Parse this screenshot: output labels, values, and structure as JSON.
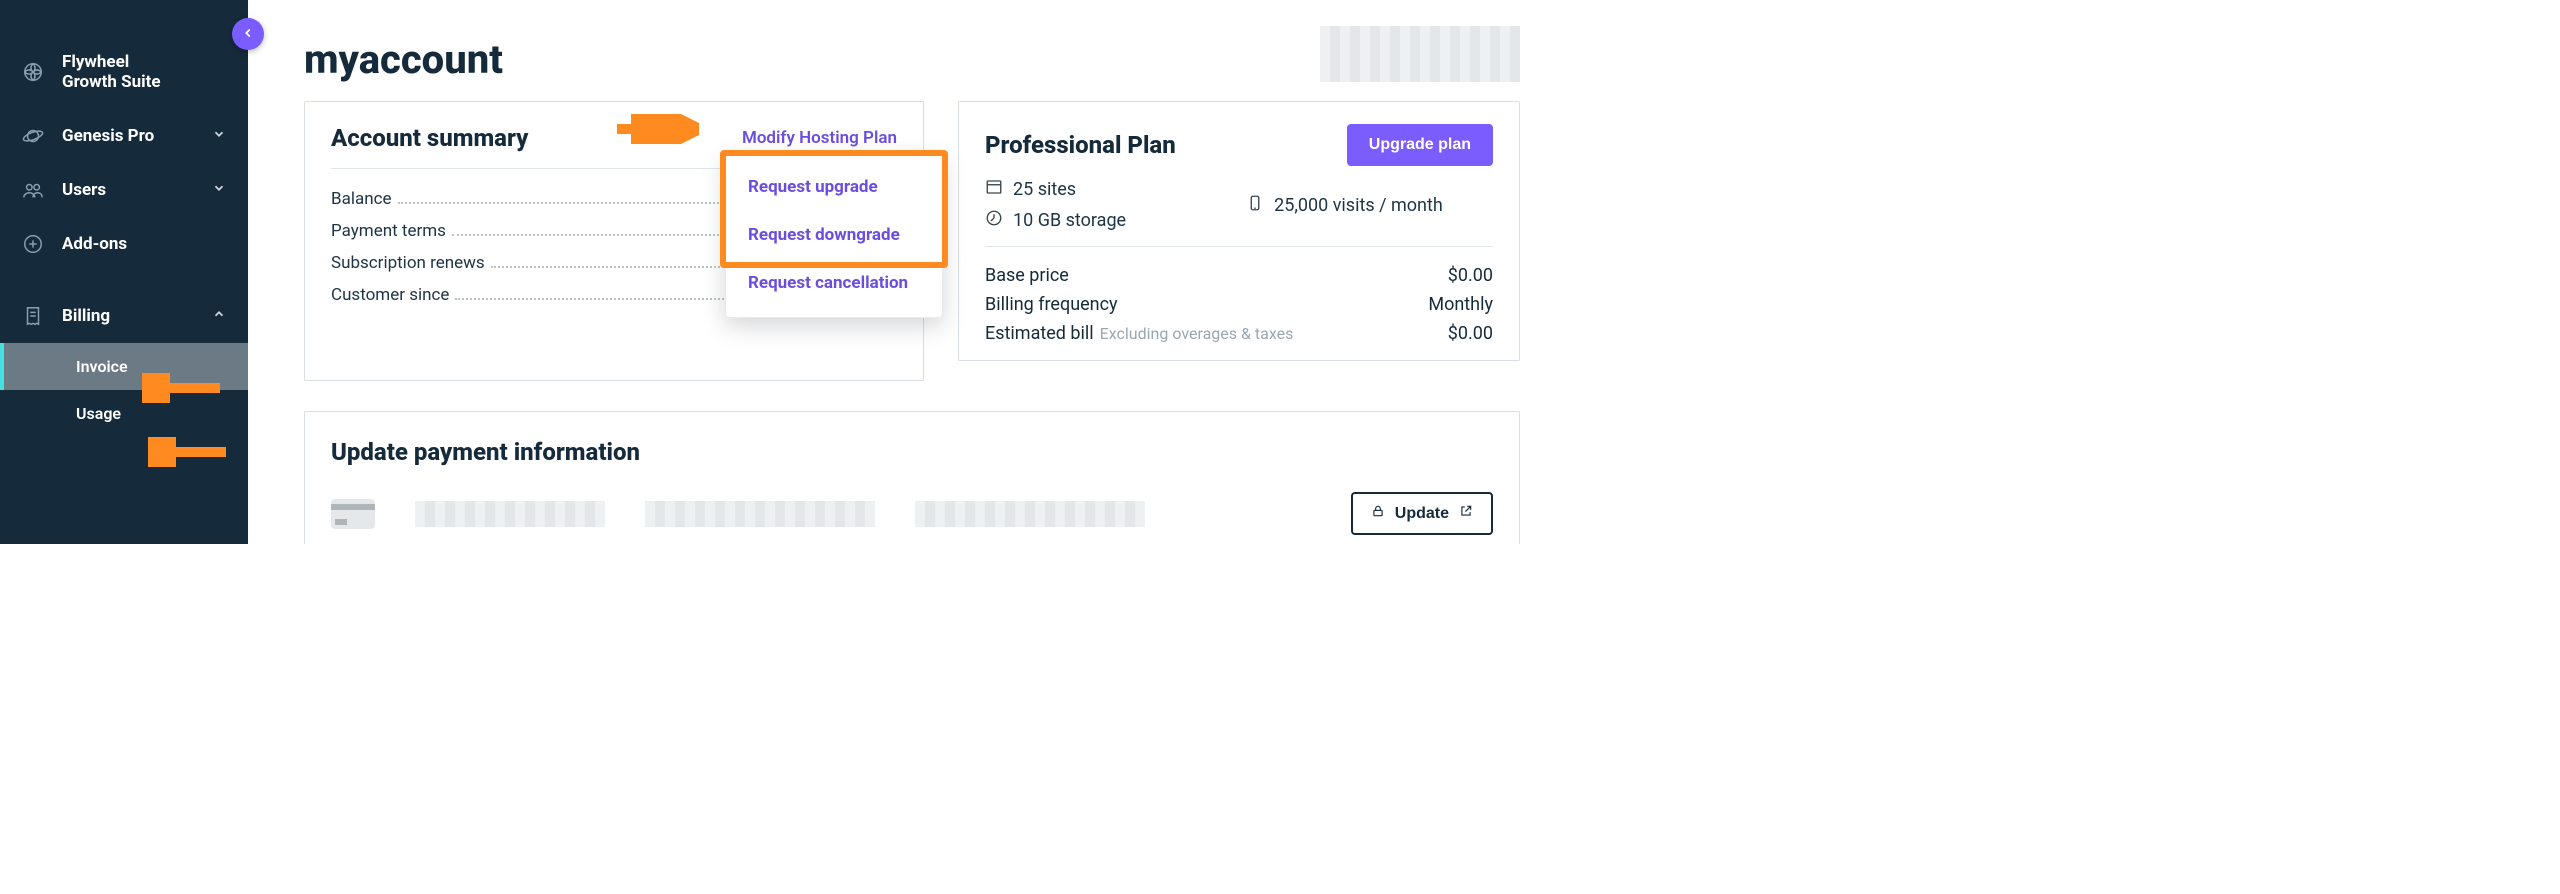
{
  "sidebar": {
    "items": [
      {
        "label": "Flywheel\nGrowth Suite"
      },
      {
        "label": "Genesis Pro"
      },
      {
        "label": "Users"
      },
      {
        "label": "Add-ons"
      },
      {
        "label": "Billing"
      }
    ],
    "sub": {
      "invoice": "Invoice",
      "usage": "Usage"
    }
  },
  "page": {
    "title": "myaccount"
  },
  "summary": {
    "heading": "Account summary",
    "modify": "Modify Hosting Plan",
    "rows": {
      "balance": "Balance",
      "terms": "Payment terms",
      "renews": "Subscription renews",
      "since": "Customer since"
    },
    "dropdown": {
      "upgrade": "Request upgrade",
      "downgrade": "Request downgrade",
      "cancel": "Request cancellation"
    }
  },
  "plan": {
    "heading": "Professional Plan",
    "upgrade_btn": "Upgrade plan",
    "specs": {
      "sites": "25 sites",
      "visits": "25,000 visits / month",
      "storage": "10 GB storage"
    },
    "rows": {
      "base_label": "Base price",
      "base_value": "$0.00",
      "freq_label": "Billing frequency",
      "freq_value": "Monthly",
      "est_label": "Estimated bill",
      "est_note": "Excluding overages & taxes",
      "est_value": "$0.00"
    }
  },
  "payment": {
    "heading": "Update payment information",
    "update_btn": "Update"
  }
}
